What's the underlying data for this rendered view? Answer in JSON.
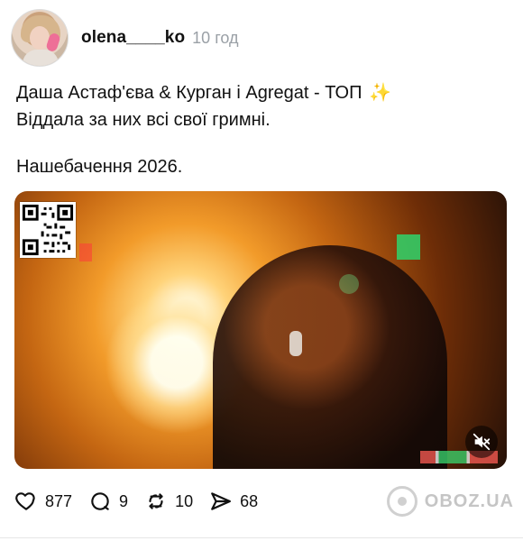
{
  "post": {
    "username": "olena____ko",
    "time": "10 год",
    "text_line1": "Даша Астаф'єва & Курган і Agregat - ТОП",
    "text_line2": "Віддала за них всі свої гримні.",
    "text_line3": "Нашебачення 2026.",
    "sparkle_icon": "sparkles-icon"
  },
  "video": {
    "qr_icon": "qr-code-icon",
    "mute_icon": "muted-speaker-icon"
  },
  "actions": {
    "likes": "877",
    "comments": "9",
    "reposts": "10",
    "shares": "68"
  },
  "watermark": {
    "text": "OBOZ.UA"
  },
  "colors": {
    "text": "#111111",
    "muted": "#9aa0a6",
    "accent_sparkle": "#f4c542"
  }
}
